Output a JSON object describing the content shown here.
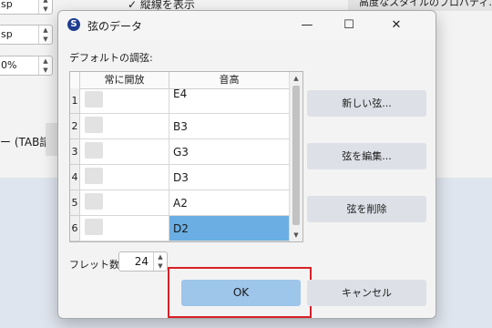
{
  "background": {
    "spinners": [
      "sp",
      "sp",
      "0%"
    ],
    "checkbox_label": "✓ 縦線を表示",
    "properties_button": "高度なスタイルのプロパティ...",
    "tab_label": "ー (TAB譜)"
  },
  "dialog": {
    "title": "弦のデータ",
    "app_icon_letter": "S",
    "controls": {
      "minimize": "—",
      "maximize": "☐",
      "close": "✕"
    },
    "section_label": "デフォルトの調弦:",
    "columns": {
      "open": "常に開放",
      "pitch": "音高"
    },
    "rows": [
      {
        "num": "1",
        "pitch": "E4"
      },
      {
        "num": "2",
        "pitch": "B3"
      },
      {
        "num": "3",
        "pitch": "G3"
      },
      {
        "num": "4",
        "pitch": "D3"
      },
      {
        "num": "5",
        "pitch": "A2"
      },
      {
        "num": "6",
        "pitch": "D2"
      }
    ],
    "selected_row": 6,
    "buttons": {
      "new": "新しい弦...",
      "edit": "弦を編集...",
      "delete": "弦を削除",
      "ok": "OK",
      "cancel": "キャンセル"
    },
    "fret_label": "フレット数:",
    "fret_value": "24"
  },
  "colors": {
    "selection": "#6aaee3",
    "ok_button": "#9ec5ea",
    "highlight_box": "#d92027"
  }
}
